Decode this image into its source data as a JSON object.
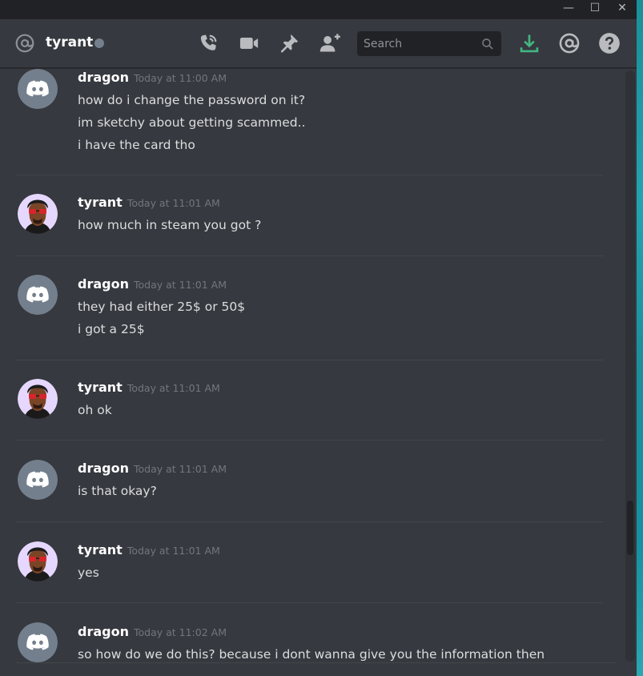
{
  "window": {
    "minimize_glyph": "—",
    "maximize_glyph": "☐",
    "close_glyph": "✕"
  },
  "header": {
    "channel_name": "tyrant",
    "status": "offline",
    "icons": [
      "at-icon",
      "call-icon",
      "video-icon",
      "pin-icon",
      "add-friend-icon",
      "download-icon",
      "mentions-icon",
      "help-icon"
    ],
    "search_placeholder": "Search"
  },
  "colors": {
    "background": "#36393f",
    "titlebar": "#202225",
    "username": "#ffffff",
    "timestamp": "#72767d",
    "message_text": "#dcddde",
    "download_accent": "#43b581",
    "discord_avatar": "#747f8d"
  },
  "messages": [
    {
      "author": "dragon",
      "timestamp": "Today at 11:00 AM",
      "avatar": "discord-default-avatar",
      "lines": [
        "how do i change the password on it?",
        "im sketchy about getting scammed..",
        "i have the card tho"
      ]
    },
    {
      "author": "tyrant",
      "timestamp": "Today at 11:01 AM",
      "avatar": "cartoon-portrait-avatar",
      "lines": [
        "how much in steam you got ?"
      ]
    },
    {
      "author": "dragon",
      "timestamp": "Today at 11:01 AM",
      "avatar": "discord-default-avatar",
      "lines": [
        "they had either 25$ or 50$",
        "i got a 25$"
      ]
    },
    {
      "author": "tyrant",
      "timestamp": "Today at 11:01 AM",
      "avatar": "cartoon-portrait-avatar",
      "lines": [
        "oh ok"
      ]
    },
    {
      "author": "dragon",
      "timestamp": "Today at 11:01 AM",
      "avatar": "discord-default-avatar",
      "lines": [
        "is that okay?"
      ]
    },
    {
      "author": "tyrant",
      "timestamp": "Today at 11:01 AM",
      "avatar": "cartoon-portrait-avatar",
      "lines": [
        "yes"
      ]
    },
    {
      "author": "dragon",
      "timestamp": "Today at 11:02 AM",
      "avatar": "discord-default-avatar",
      "lines": [
        "so how do we do this? because i dont wanna give you the information then"
      ]
    }
  ]
}
